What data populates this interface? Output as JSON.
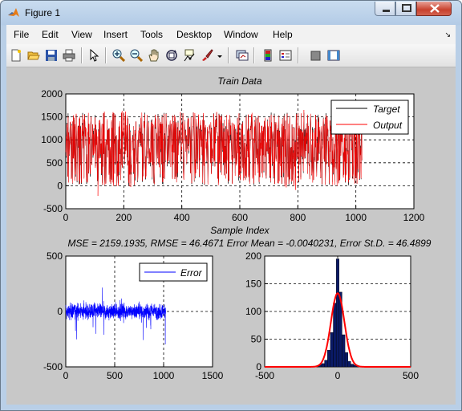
{
  "window": {
    "title": "Figure 1"
  },
  "menu": [
    "File",
    "Edit",
    "View",
    "Insert",
    "Tools",
    "Desktop",
    "Window",
    "Help"
  ],
  "toolbar_icons": [
    "new-figure-icon",
    "open-file-icon",
    "save-icon",
    "print-icon",
    "pointer-icon",
    "zoom-in-icon",
    "zoom-out-icon",
    "pan-hand-icon",
    "rotate-3d-icon",
    "data-cursor-icon",
    "brush-icon",
    "brush-dropdown-icon",
    "link-plot-icon",
    "insert-colorbar-icon",
    "insert-legend-icon",
    "hide-plot-tools-icon",
    "show-plot-tools-icon"
  ],
  "colors": {
    "target": "#000000",
    "output": "#ff0000",
    "error": "#0000ff",
    "hist_bar": "#0a1a66",
    "fit": "#ff0000"
  },
  "chart_data": [
    {
      "type": "line",
      "title": "Train Data",
      "xlabel": "Sample Index",
      "ylabel": "",
      "xlim": [
        0,
        1200
      ],
      "ylim": [
        -500,
        2000
      ],
      "xticks": [
        0,
        200,
        400,
        600,
        800,
        1000,
        1200
      ],
      "yticks": [
        -500,
        0,
        500,
        1000,
        1500,
        2000
      ],
      "grid": "dashed",
      "legend_position": "top-right",
      "series": [
        {
          "name": "Target",
          "color": "#000000",
          "n": 1022,
          "range": [
            0,
            1600
          ]
        },
        {
          "name": "Output",
          "color": "#ff0000",
          "n": 1022,
          "range": [
            -50,
            1650
          ]
        }
      ]
    },
    {
      "type": "line",
      "title": "MSE = 2159.1935, RMSE = 46.4671 Error Mean = -0.0040231, Error St.D. = 46.4899",
      "xlim": [
        0,
        1500
      ],
      "ylim": [
        -500,
        500
      ],
      "xticks": [
        0,
        500,
        1000,
        1500
      ],
      "yticks": [
        -500,
        0,
        500
      ],
      "grid": "dashed",
      "legend_position": "top-right",
      "series": [
        {
          "name": "Error",
          "color": "#0000ff",
          "n": 1022,
          "range": [
            -350,
            300
          ]
        }
      ]
    },
    {
      "type": "bar",
      "title": "",
      "xlim": [
        -500,
        500
      ],
      "ylim": [
        0,
        200
      ],
      "xticks": [
        -500,
        0,
        500
      ],
      "yticks": [
        0,
        50,
        100,
        150,
        200
      ],
      "grid": "dashed",
      "bins": [
        -140,
        -120,
        -100,
        -80,
        -60,
        -40,
        -20,
        0,
        20,
        40,
        60,
        80,
        100,
        120,
        140
      ],
      "values": [
        2,
        4,
        6,
        12,
        30,
        62,
        115,
        195,
        135,
        58,
        26,
        10,
        5,
        3,
        2
      ],
      "fit_peak": 133
    }
  ]
}
